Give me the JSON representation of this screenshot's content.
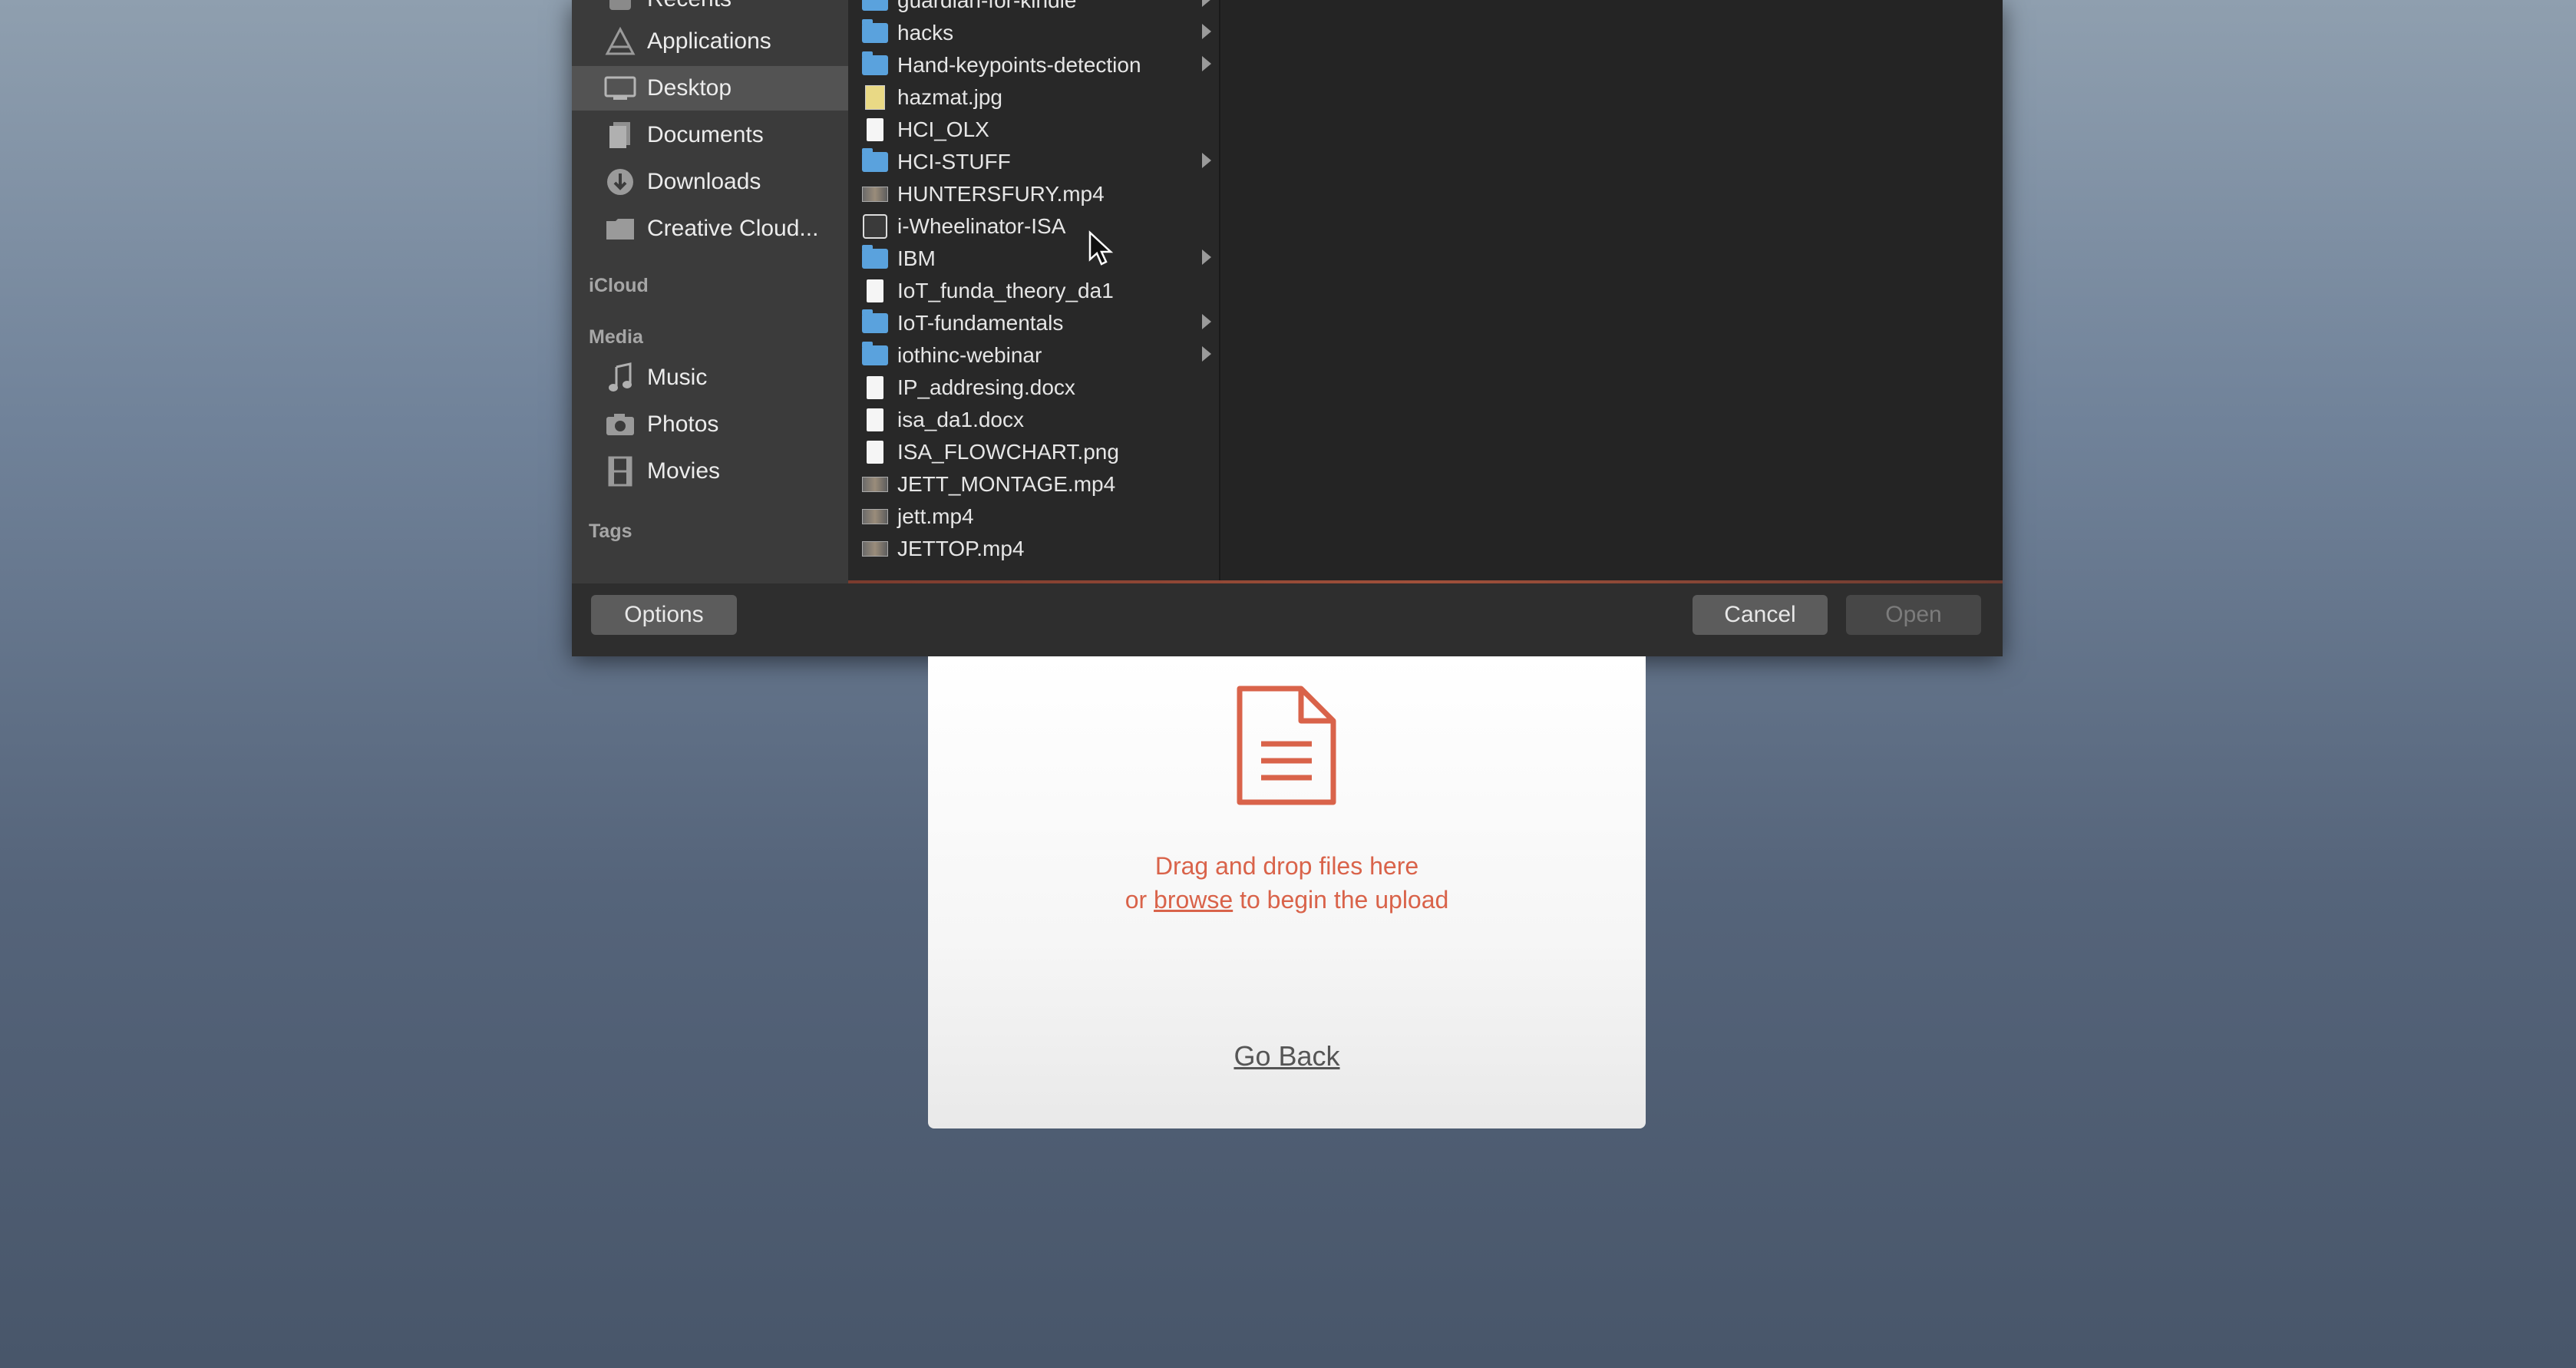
{
  "sidebar": {
    "items": [
      {
        "label": "Recents",
        "icon": "recents-icon"
      },
      {
        "label": "Applications",
        "icon": "applications-icon"
      },
      {
        "label": "Desktop",
        "icon": "desktop-icon",
        "selected": true
      },
      {
        "label": "Documents",
        "icon": "documents-icon"
      },
      {
        "label": "Downloads",
        "icon": "downloads-icon"
      },
      {
        "label": "Creative Cloud...",
        "icon": "folder-icon"
      }
    ],
    "icloud_header": "iCloud",
    "media_header": "Media",
    "media_items": [
      {
        "label": "Music",
        "icon": "music-icon"
      },
      {
        "label": "Photos",
        "icon": "photos-icon"
      },
      {
        "label": "Movies",
        "icon": "movies-icon"
      }
    ],
    "tags_header": "Tags"
  },
  "files": [
    {
      "name": "guardian-for-kindle",
      "type": "folder"
    },
    {
      "name": "hacks",
      "type": "folder"
    },
    {
      "name": "Hand-keypoints-detection",
      "type": "folder"
    },
    {
      "name": "hazmat.jpg",
      "type": "image"
    },
    {
      "name": "HCI_OLX",
      "type": "doc"
    },
    {
      "name": "HCI-STUFF",
      "type": "folder"
    },
    {
      "name": "HUNTERSFURY.mp4",
      "type": "video"
    },
    {
      "name": "i-Wheelinator-ISA",
      "type": "app"
    },
    {
      "name": "IBM",
      "type": "folder"
    },
    {
      "name": "IoT_funda_theory_da1",
      "type": "doc"
    },
    {
      "name": "IoT-fundamentals",
      "type": "folder"
    },
    {
      "name": "iothinc-webinar",
      "type": "folder"
    },
    {
      "name": "IP_addresing.docx",
      "type": "doc"
    },
    {
      "name": "isa_da1.docx",
      "type": "doc"
    },
    {
      "name": "ISA_FLOWCHART.png",
      "type": "doc"
    },
    {
      "name": "JETT_MONTAGE.mp4",
      "type": "video"
    },
    {
      "name": "jett.mp4",
      "type": "video"
    },
    {
      "name": "JETTOP.mp4",
      "type": "video"
    }
  ],
  "footer": {
    "options_label": "Options",
    "cancel_label": "Cancel",
    "open_label": "Open"
  },
  "upload": {
    "drop_line1": "Drag and drop files here",
    "drop_or": "or ",
    "browse_label": "browse",
    "drop_rest": " to begin the upload",
    "go_back_label": "Go Back"
  },
  "colors": {
    "accent": "#d9634a",
    "folder": "#5aa2dd"
  }
}
